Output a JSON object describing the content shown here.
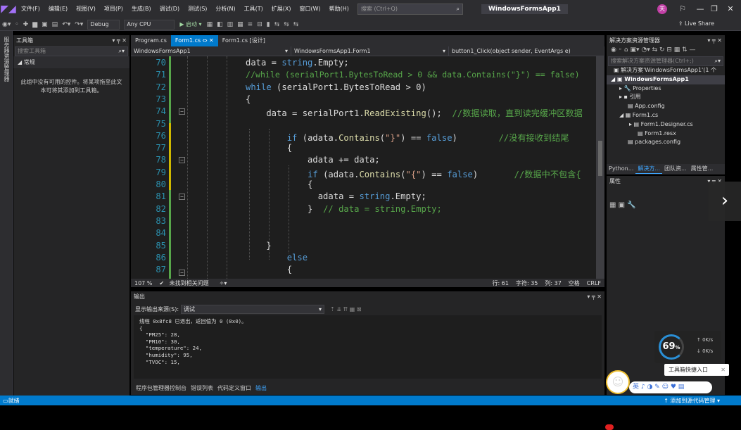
{
  "menubar": {
    "items": [
      "文件(F)",
      "编辑(E)",
      "视图(V)",
      "项目(P)",
      "生成(B)",
      "调试(D)",
      "测试(S)",
      "分析(N)",
      "工具(T)",
      "扩展(X)",
      "窗口(W)",
      "帮助(H)"
    ],
    "search_placeholder": "搜索 (Ctrl+Q)",
    "window_title": "WindowsFormsApp1",
    "avatar": "天"
  },
  "toolbar": {
    "config": "Debug",
    "platform": "Any CPU",
    "start": "▶ 启动 ▾",
    "live_share": "Live Share"
  },
  "left_strip": {
    "label": "服务器资源管理器"
  },
  "toolbox": {
    "title": "工具箱",
    "search_placeholder": "搜索工具箱",
    "group": "◢ 常规",
    "empty": "此组中没有可用的控件。将某项拖至此文本可将其添加到工具箱。"
  },
  "editor": {
    "tabs": [
      "Program.cs",
      "Form1.cs ⇔ ✕",
      "Form1.cs [设计]"
    ],
    "nav": [
      "WindowsFormsApp1",
      "WindowsFormsApp1.Form1",
      "button1_Click(object sender, EventArgs e)"
    ],
    "lines": [
      "70",
      "71",
      "72",
      "73",
      "74",
      "75",
      "76",
      "77",
      "78",
      "79",
      "80",
      "81",
      "82",
      "83",
      "84",
      "85",
      "86",
      "87"
    ],
    "status": {
      "zoom": "107 %",
      "issues": "未找到相关问题",
      "line": "行: 61",
      "char": "字符: 35",
      "col": "列: 37",
      "spaces": "空格",
      "eol": "CRLF"
    }
  },
  "output": {
    "title": "输出",
    "source_label": "显示输出来源(S):",
    "source_value": "调试",
    "text": "线程 0x8fc8 已退出，返回值为 0 (0x0)。\n{\n  \"PM25\": 28,\n  \"PM10\": 30,\n  \"temperature\": 24,\n  \"humidity\": 95,\n  \"TVOC\": 15,",
    "tabs": [
      "程序包管理器控制台",
      "错误列表",
      "代码定义窗口",
      "输出"
    ]
  },
  "solution": {
    "title": "解决方案资源管理器",
    "search_placeholder": "搜索解决方案资源管理器(Ctrl+;)",
    "items": [
      "解决方案'WindowsFormsApp1'(1 个",
      "WindowsFormsApp1",
      "Properties",
      "引用",
      "App.config",
      "Form1.cs",
      "Form1.Designer.cs",
      "Form1.resx",
      "packages.config"
    ],
    "tabs": [
      "Python...",
      "解决方...",
      "团队资...",
      "属性管..."
    ]
  },
  "properties": {
    "title": "属性"
  },
  "statusbar": {
    "left": "就绪",
    "right": "↑ 添加到源代码管理 ▾"
  },
  "overlay": {
    "gauge": "69",
    "gauge_unit": "%",
    "up": "0K/s",
    "down": "0K/s",
    "tooltip": "工具箱快捷入口",
    "ime": "英 ♪ ◑ ✎ ☺ ♥ ▤"
  }
}
